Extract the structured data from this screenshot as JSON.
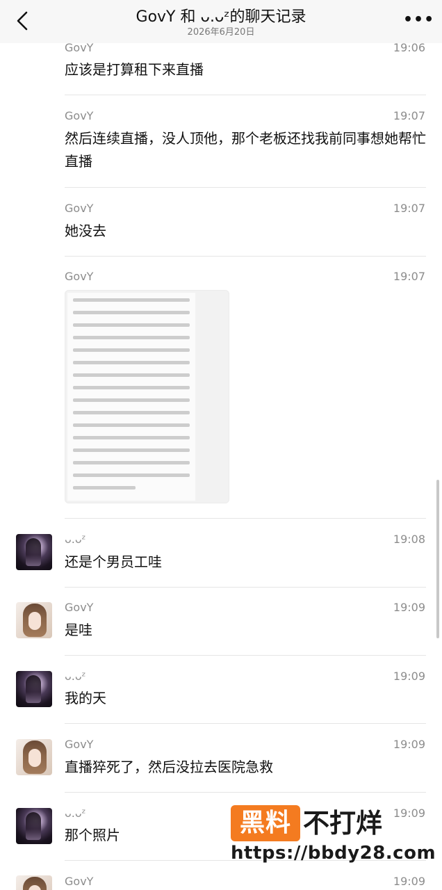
{
  "header": {
    "title": "GovY 和 ᴗ.ᴗᶻ的聊天记录",
    "subtitle": "2026年6月20日",
    "back_icon": "chevron-left-icon",
    "more_icon": "more-dots-icon",
    "more_label": "•••"
  },
  "messages": [
    {
      "sender": "GovY",
      "time": "19:06",
      "text": "应该是打算租下来直播",
      "avatar": "none"
    },
    {
      "sender": "GovY",
      "time": "19:07",
      "text": "然后连续直播，没人顶他，那个老板还找我前同事想她帮忙直播",
      "avatar": "none"
    },
    {
      "sender": "GovY",
      "time": "19:07",
      "text": "她没去",
      "avatar": "none"
    },
    {
      "sender": "GovY",
      "time": "19:07",
      "text": "",
      "avatar": "none",
      "type": "image"
    },
    {
      "sender": "ᴗ.ᴗᶻ",
      "time": "19:08",
      "text": "还是个男员工哇",
      "avatar": "dark"
    },
    {
      "sender": "GovY",
      "time": "19:09",
      "text": "是哇",
      "avatar": "light"
    },
    {
      "sender": "ᴗ.ᴗᶻ",
      "time": "19:09",
      "text": "我的天",
      "avatar": "dark"
    },
    {
      "sender": "GovY",
      "time": "19:09",
      "text": "直播猝死了，然后没拉去医院急救",
      "avatar": "light"
    },
    {
      "sender": "ᴗ.ᴗᶻ",
      "time": "19:09",
      "text": "那个照片",
      "avatar": "dark"
    },
    {
      "sender": "GovY",
      "time": "19:09",
      "text": "",
      "avatar": "light"
    }
  ],
  "watermark": {
    "badge": "黑料",
    "right": "不打烊",
    "url": "https://bbdy28.com"
  },
  "colors": {
    "header_bg": "#f7f7f7",
    "watermark_orange": "#f47b20",
    "meta_gray": "#8c8c8c"
  }
}
